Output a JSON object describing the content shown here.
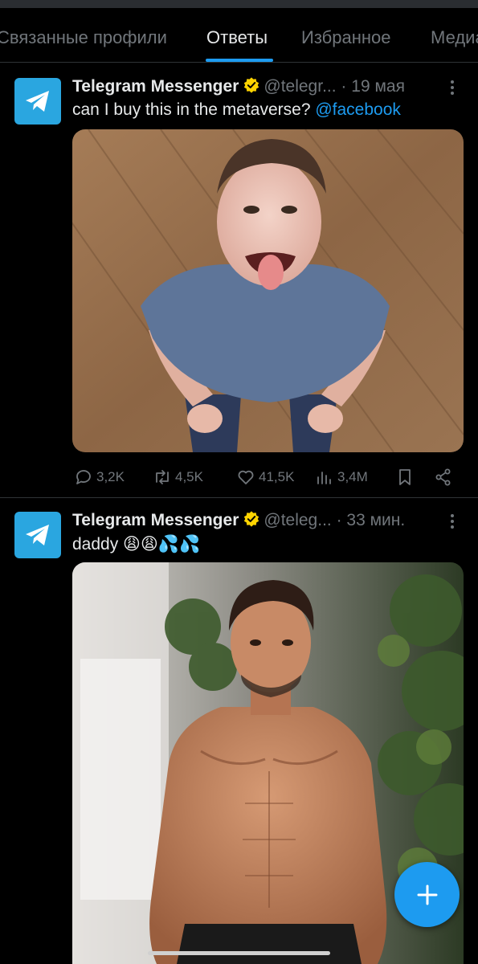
{
  "tabs": [
    {
      "label": "Связанные профили",
      "active": false
    },
    {
      "label": "Ответы",
      "active": true
    },
    {
      "label": "Избранное",
      "active": false
    },
    {
      "label": "Медиа",
      "active": false
    }
  ],
  "tweets": [
    {
      "display_name": "Telegram Messenger",
      "verified_icon": "verified-badge-icon",
      "handle": "@telegr...",
      "separator": "·",
      "time": "19 мая",
      "text": "can I buy this in the metaverse?",
      "mention": "@facebook",
      "media": "photo",
      "stats": {
        "replies": "3,2K",
        "reposts": "4,5K",
        "likes": "41,5K",
        "views": "3,4M"
      }
    },
    {
      "display_name": "Telegram Messenger",
      "verified_icon": "verified-badge-icon",
      "handle": "@teleg...",
      "separator": "·",
      "time": "33 мин.",
      "text": "daddy 😩😩💦💦",
      "media": "photo"
    }
  ],
  "fab": {
    "icon": "plus-icon"
  },
  "colors": {
    "accent": "#1d9bf0",
    "background": "#000000",
    "muted_text": "#71767b",
    "verified": "#ffd400",
    "telegram": "#2aa6e0"
  }
}
